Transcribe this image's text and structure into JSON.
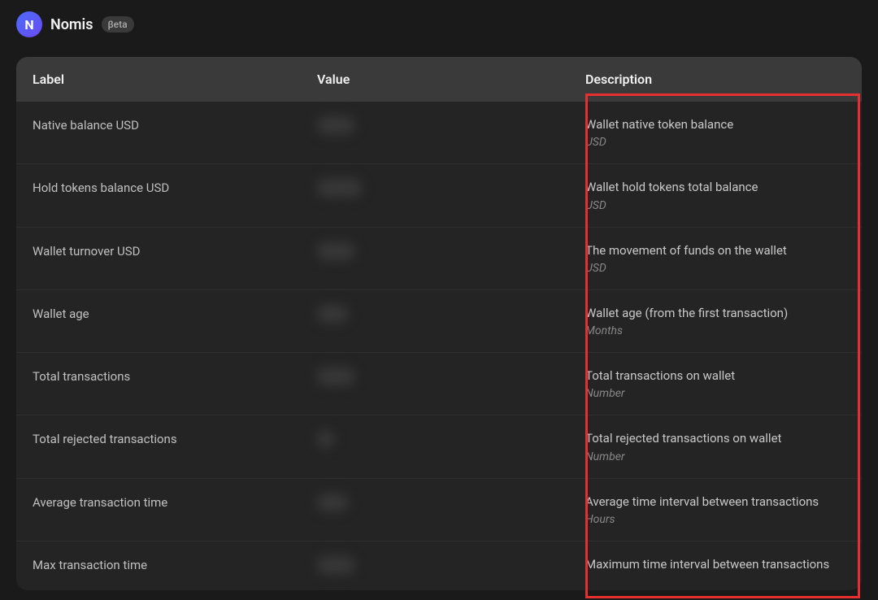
{
  "header": {
    "logo_letter": "N",
    "brand": "Nomis",
    "badge": "βeta"
  },
  "table": {
    "columns": {
      "label": "Label",
      "value": "Value",
      "description": "Description"
    },
    "rows": [
      {
        "label": "Native balance USD",
        "value": "0000",
        "desc": "Wallet native token balance",
        "unit": "USD"
      },
      {
        "label": "Hold tokens balance USD",
        "value": "00000",
        "desc": "Wallet hold tokens total balance",
        "unit": "USD"
      },
      {
        "label": "Wallet turnover USD",
        "value": "0000",
        "desc": "The movement of funds on the wallet",
        "unit": "USD"
      },
      {
        "label": "Wallet age",
        "value": "000",
        "desc": "Wallet age (from the first transaction)",
        "unit": "Months"
      },
      {
        "label": "Total transactions",
        "value": "0000",
        "desc": "Total transactions on wallet",
        "unit": "Number"
      },
      {
        "label": "Total rejected transactions",
        "value": "0",
        "desc": "Total rejected transactions on wallet",
        "unit": "Number"
      },
      {
        "label": "Average transaction time",
        "value": "000",
        "desc": "Average time interval between transactions",
        "unit": "Hours"
      },
      {
        "label": "Max transaction time",
        "value": "0000",
        "desc": "Maximum time interval between transactions",
        "unit": ""
      }
    ]
  }
}
